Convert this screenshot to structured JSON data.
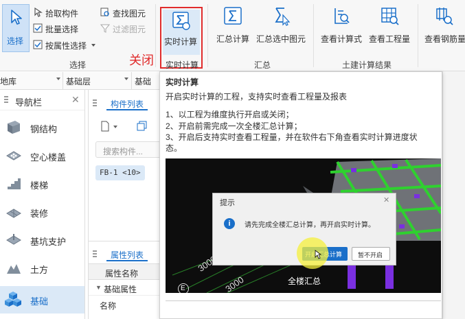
{
  "ribbon": {
    "select_label": "选择",
    "pick_component": "拾取构件",
    "batch_select": "批量选择",
    "select_by_attr": "按属性选择",
    "find_element": "查找图元",
    "filter_element": "过滤图元",
    "select_group": "选择",
    "realtime_calc": "实时计算",
    "realtime_group": "实时计算",
    "annotation": "关闭",
    "sum_calc": "汇总计算",
    "sum_selected": "汇总选中图元",
    "sum_group": "汇总",
    "view_formula": "查看计算式",
    "view_quantity": "查看工程量",
    "civil_group": "土建计算结果",
    "view_rebar": "查看钢筋量"
  },
  "filters": {
    "floor": "地库",
    "layer": "基础层",
    "category": "基础"
  },
  "nav": {
    "title": "导航栏",
    "items": [
      {
        "label": "钢结构"
      },
      {
        "label": "空心楼盖"
      },
      {
        "label": "楼梯"
      },
      {
        "label": "装修"
      },
      {
        "label": "基坑支护"
      },
      {
        "label": "土方"
      },
      {
        "label": "基础"
      }
    ]
  },
  "component_panel": {
    "tab": "构件列表",
    "search_placeholder": "搜索构件...",
    "item": "FB-1 <10>",
    "props_tab": "属性列表",
    "props_header": "属性名称",
    "props_group": "基础属性",
    "props_row": "名称"
  },
  "tooltip": {
    "title": "实时计算",
    "desc": "开启实时计算的工程，支持实时查看工程量及报表",
    "line1": "1、以工程为维度执行开启或关闭；",
    "line2": "2、开启前需完成一次全楼汇总计算；",
    "line3": "3、开启后支持实时查看工程量，并在软件右下角查看实时计算进度状态。",
    "dialog_title": "提示",
    "dialog_message": "请先完成全楼汇总计算，再开启实时计算。",
    "dialog_primary": "开启汇总计算",
    "dialog_secondary": "暂不开启",
    "dim1": "3000",
    "dim2": "3000",
    "caption": "全楼汇总",
    "marker": "E"
  },
  "colors": {
    "accent": "#1a6fc9",
    "highlight_box": "#e02b2b",
    "annotation": "#e02b2b"
  }
}
